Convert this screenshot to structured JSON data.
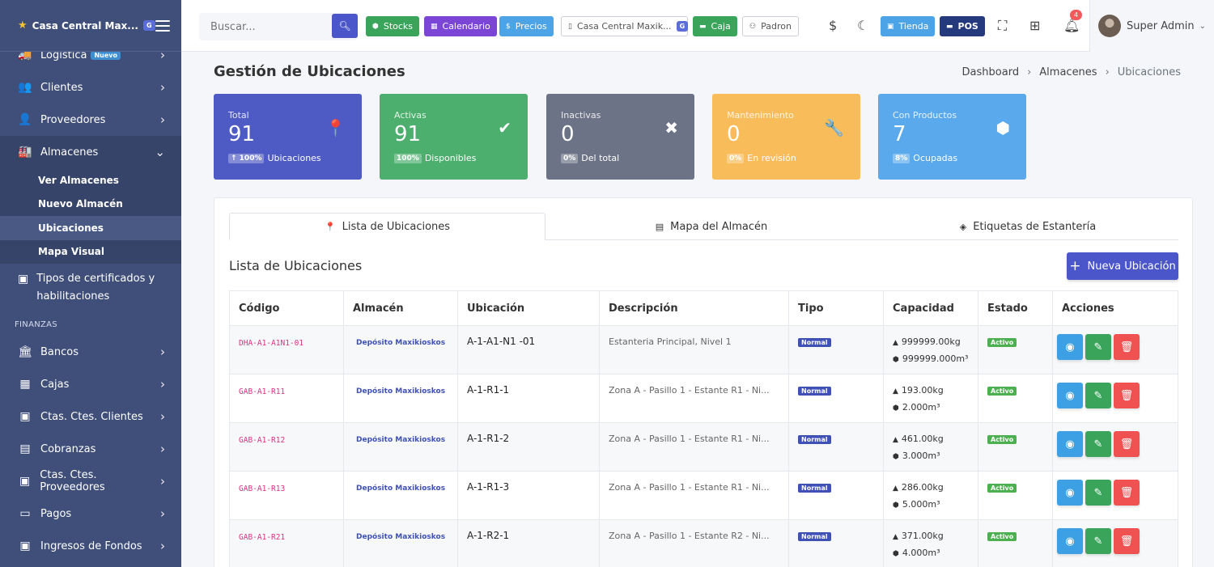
{
  "brand": {
    "name": "Casa Central Max...",
    "badge": "G"
  },
  "sidebar": {
    "items_top": [
      {
        "icon": "truck-icon",
        "glyph": "🚚",
        "label": "Logística",
        "badge": "Nuevo"
      },
      {
        "icon": "users-icon",
        "glyph": "👥",
        "label": "Clientes"
      },
      {
        "icon": "user-icon",
        "glyph": "👤",
        "label": "Proveedores"
      },
      {
        "icon": "warehouse-icon",
        "glyph": "🏭",
        "label": "Almacenes"
      }
    ],
    "almacenes_sub": [
      "Ver Almacenes",
      "Nuevo Almacén",
      "Ubicaciones",
      "Mapa Visual"
    ],
    "certificados": "Tipos de certificados y habilitaciones",
    "section": "FINANZAS",
    "finanzas": [
      {
        "icon": "bank-icon",
        "glyph": "🏛",
        "label": "Bancos"
      },
      {
        "icon": "cash-register-icon",
        "glyph": "▦",
        "label": "Cajas"
      },
      {
        "icon": "client-accounts-icon",
        "glyph": "▣",
        "label": "Ctas. Ctes. Clientes"
      },
      {
        "icon": "collections-icon",
        "glyph": "▤",
        "label": "Cobranzas"
      },
      {
        "icon": "supplier-accounts-icon",
        "glyph": "▣",
        "label": "Ctas. Ctes. Proveedores"
      },
      {
        "icon": "payments-icon",
        "glyph": "▭",
        "label": "Pagos"
      },
      {
        "icon": "funds-income-icon",
        "glyph": "▣",
        "label": "Ingresos de Fondos"
      }
    ]
  },
  "topbar": {
    "search_placeholder": "Buscar...",
    "buttons": {
      "stocks": "Stocks",
      "calendario": "Calendario",
      "precios": "Precios",
      "sucursal": "Casa Central Maxik...",
      "sucursal_badge": "G",
      "caja": "Caja",
      "padron": "Padron",
      "tienda": "Tienda",
      "pos": "POS"
    },
    "notifications": "4",
    "user": "Super Admin"
  },
  "page": {
    "title": "Gestión de Ubicaciones",
    "breadcrumb": [
      "Dashboard",
      "Almacenes",
      "Ubicaciones"
    ]
  },
  "stats": [
    {
      "label": "Total",
      "value": "91",
      "pct": "↑ 100%",
      "text": "Ubicaciones",
      "color": "#4f5bc4",
      "icon": "map-marker-icon",
      "glyph": "📍"
    },
    {
      "label": "Activas",
      "value": "91",
      "pct": "100%",
      "text": "Disponibles",
      "color": "#4caf6d",
      "icon": "check-circle-icon",
      "glyph": "✔"
    },
    {
      "label": "Inactivas",
      "value": "0",
      "pct": "0%",
      "text": "Del total",
      "color": "#6c7386",
      "icon": "times-circle-icon",
      "glyph": "✖"
    },
    {
      "label": "Mantenimiento",
      "value": "0",
      "pct": "0%",
      "text": "En revisión",
      "color": "#f9bc5a",
      "icon": "wrench-icon",
      "glyph": "🔧"
    },
    {
      "label": "Con Productos",
      "value": "7",
      "pct": "8%",
      "text": "Ocupadas",
      "color": "#5aa9ec",
      "icon": "box-icon",
      "glyph": "⬢"
    }
  ],
  "tabs": [
    "Lista de Ubicaciones",
    "Mapa del Almacén",
    "Etiquetas de Estantería"
  ],
  "list": {
    "title": "Lista de Ubicaciones",
    "new_button": "Nueva Ubicación",
    "columns": [
      "Código",
      "Almacén",
      "Ubicación",
      "Descripción",
      "Tipo",
      "Capacidad",
      "Estado",
      "Acciones"
    ],
    "rows": [
      {
        "code": "DHA-A1-A1N1-01",
        "almacen": "Depósito Maxikioskos",
        "ubicacion": "A-1-A1-N1 -01",
        "descripcion": "Estanteria Principal, Nivel 1",
        "tipo": "Normal",
        "peso": "999999.00kg",
        "volumen": "999999.000m³",
        "estado": "Activo"
      },
      {
        "code": "GAB-A1-R11",
        "almacen": "Depósito Maxikioskos",
        "ubicacion": "A-1-R1-1",
        "descripcion": "Zona A - Pasillo 1 - Estante R1 - Ni...",
        "tipo": "Normal",
        "peso": "193.00kg",
        "volumen": "2.000m³",
        "estado": "Activo"
      },
      {
        "code": "GAB-A1-R12",
        "almacen": "Depósito Maxikioskos",
        "ubicacion": "A-1-R1-2",
        "descripcion": "Zona A - Pasillo 1 - Estante R1 - Ni...",
        "tipo": "Normal",
        "peso": "461.00kg",
        "volumen": "3.000m³",
        "estado": "Activo"
      },
      {
        "code": "GAB-A1-R13",
        "almacen": "Depósito Maxikioskos",
        "ubicacion": "A-1-R1-3",
        "descripcion": "Zona A - Pasillo 1 - Estante R1 - Ni...",
        "tipo": "Normal",
        "peso": "286.00kg",
        "volumen": "5.000m³",
        "estado": "Activo"
      },
      {
        "code": "GAB-A1-R21",
        "almacen": "Depósito Maxikioskos",
        "ubicacion": "A-1-R2-1",
        "descripcion": "Zona A - Pasillo 1 - Estante R2 - Ni...",
        "tipo": "Normal",
        "peso": "371.00kg",
        "volumen": "4.000m³",
        "estado": "Activo"
      }
    ]
  }
}
